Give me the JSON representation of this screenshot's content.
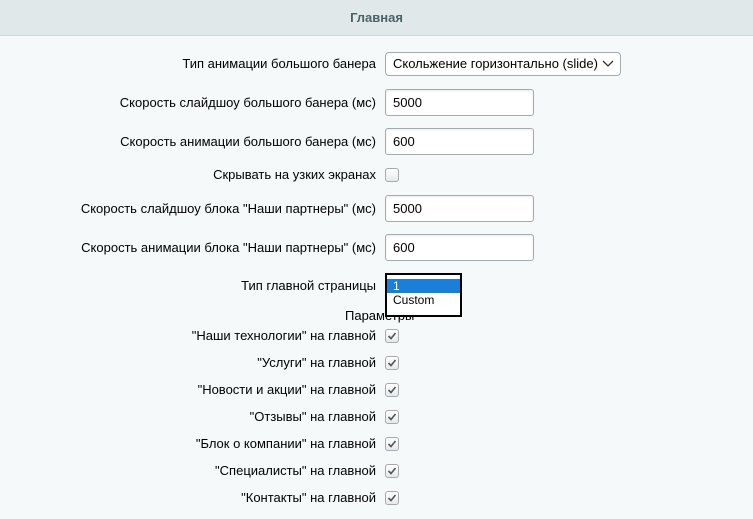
{
  "header": {
    "title": "Главная"
  },
  "fields": {
    "banner_anim_type": {
      "label": "Тип анимации большого банера",
      "value": "Скольжение горизонтально (slide)"
    },
    "banner_slideshow_speed": {
      "label": "Скорость слайдшоу большого банера (мс)",
      "value": "5000"
    },
    "banner_anim_speed": {
      "label": "Скорость анимации большого банера (мс)",
      "value": "600"
    },
    "hide_narrow": {
      "label": "Скрывать на узких экранах",
      "checked": false
    },
    "partners_slideshow_speed": {
      "label": "Скорость слайдшоу блока \"Наши партнеры\" (мс)",
      "value": "5000"
    },
    "partners_anim_speed": {
      "label": "Скорость анимации блока \"Наши партнеры\" (мс)",
      "value": "600"
    },
    "home_type": {
      "label": "Тип главной страницы",
      "options": [
        "1",
        "Custom"
      ],
      "selected": "1"
    }
  },
  "params": {
    "label": "Параметры",
    "items": [
      {
        "label": "\"Наши технологии\" на главной",
        "checked": true
      },
      {
        "label": "\"Услуги\" на главной",
        "checked": true
      },
      {
        "label": "\"Новости и акции\" на главной",
        "checked": true
      },
      {
        "label": "\"Отзывы\" на главной",
        "checked": true
      },
      {
        "label": "\"Блок о компании\" на главной",
        "checked": true
      },
      {
        "label": "\"Специалисты\" на главной",
        "checked": true
      },
      {
        "label": "\"Контакты\" на главной",
        "checked": true
      }
    ]
  },
  "colors": {
    "header_bg": "#e0e8ea",
    "panel_bg": "#f5f9f9",
    "selection": "#1a7fd9"
  }
}
